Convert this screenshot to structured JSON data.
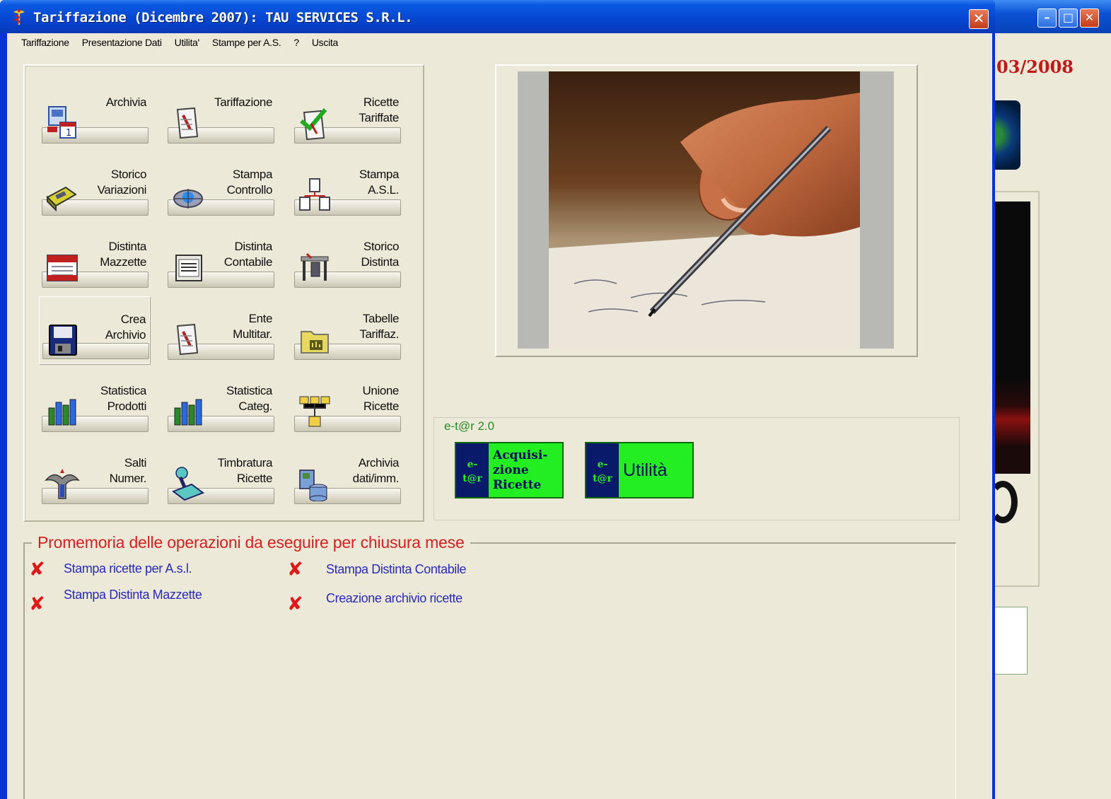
{
  "window": {
    "title": "Tariffazione (Dicembre 2007): TAU SERVICES S.R.L.",
    "close_symbol": "✕"
  },
  "background_window": {
    "date_fragment": "03/2008",
    "minimize_symbol": "–",
    "maximize_symbol": "□",
    "close_symbol": "✕"
  },
  "menu": [
    "Tariffazione",
    "Presentazione Dati",
    "Utilita'",
    "Stampe per A.S.",
    "?",
    "Uscita"
  ],
  "tools": [
    {
      "label": "Archivia",
      "icon": "calendar-archive-icon"
    },
    {
      "label": "Tariffazione",
      "icon": "pen-document-icon"
    },
    {
      "label": "Ricette\nTariffate",
      "icon": "checked-document-icon"
    },
    {
      "label": "Storico\nVariazioni",
      "icon": "ticket-icon"
    },
    {
      "label": "Stampa\nControllo",
      "icon": "network-print-icon"
    },
    {
      "label": "Stampa\nA.S.L.",
      "icon": "document-tree-icon"
    },
    {
      "label": "Distinta\nMazzette",
      "icon": "calendar-icon"
    },
    {
      "label": "Distinta\nContabile",
      "icon": "ledger-icon"
    },
    {
      "label": "Storico\nDistinta",
      "icon": "desk-chair-icon"
    },
    {
      "label": "Crea\nArchivio",
      "icon": "floppy-disk-icon"
    },
    {
      "label": "Ente\nMultitar.",
      "icon": "pen-document-icon"
    },
    {
      "label": "Tabelle\nTariffaz.",
      "icon": "folder-chart-icon"
    },
    {
      "label": "Statistica\nProdotti",
      "icon": "bar-chart-icon"
    },
    {
      "label": "Statistica\nCateg.",
      "icon": "bar-chart-icon"
    },
    {
      "label": "Unione\nRicette",
      "icon": "merge-icon"
    },
    {
      "label": "Salti\nNumer.",
      "icon": "eagle-icon"
    },
    {
      "label": "Timbratura\nRicette",
      "icon": "rubber-stamp-icon"
    },
    {
      "label": "Archivia\ndati/imm.",
      "icon": "database-image-icon"
    }
  ],
  "etar": {
    "group_title": "e-t@r 2.0",
    "logo_text": "e-\nt@r",
    "acquisizione_label": "Acquisi-\nzione\nRicette",
    "utilita_label": "Utilità"
  },
  "reminder": {
    "title": "Promemoria delle operazioni da eseguire per chiusura mese",
    "tasks": [
      {
        "label": "Stampa ricette per A.s.l.",
        "status": "not-done"
      },
      {
        "label": "Stampa Distinta Contabile",
        "status": "not-done"
      },
      {
        "label": "Stampa Distinta Mazzette",
        "status": "not-done"
      },
      {
        "label": "Creazione archivio ricette",
        "status": "not-done"
      }
    ],
    "status_symbol": "✘"
  },
  "colors": {
    "title_blue": "#0645d0",
    "reminder_red": "#d42020",
    "task_blue": "#2a2ab8",
    "etar_green": "#22ee22",
    "etar_navy": "#0a1a6a"
  }
}
